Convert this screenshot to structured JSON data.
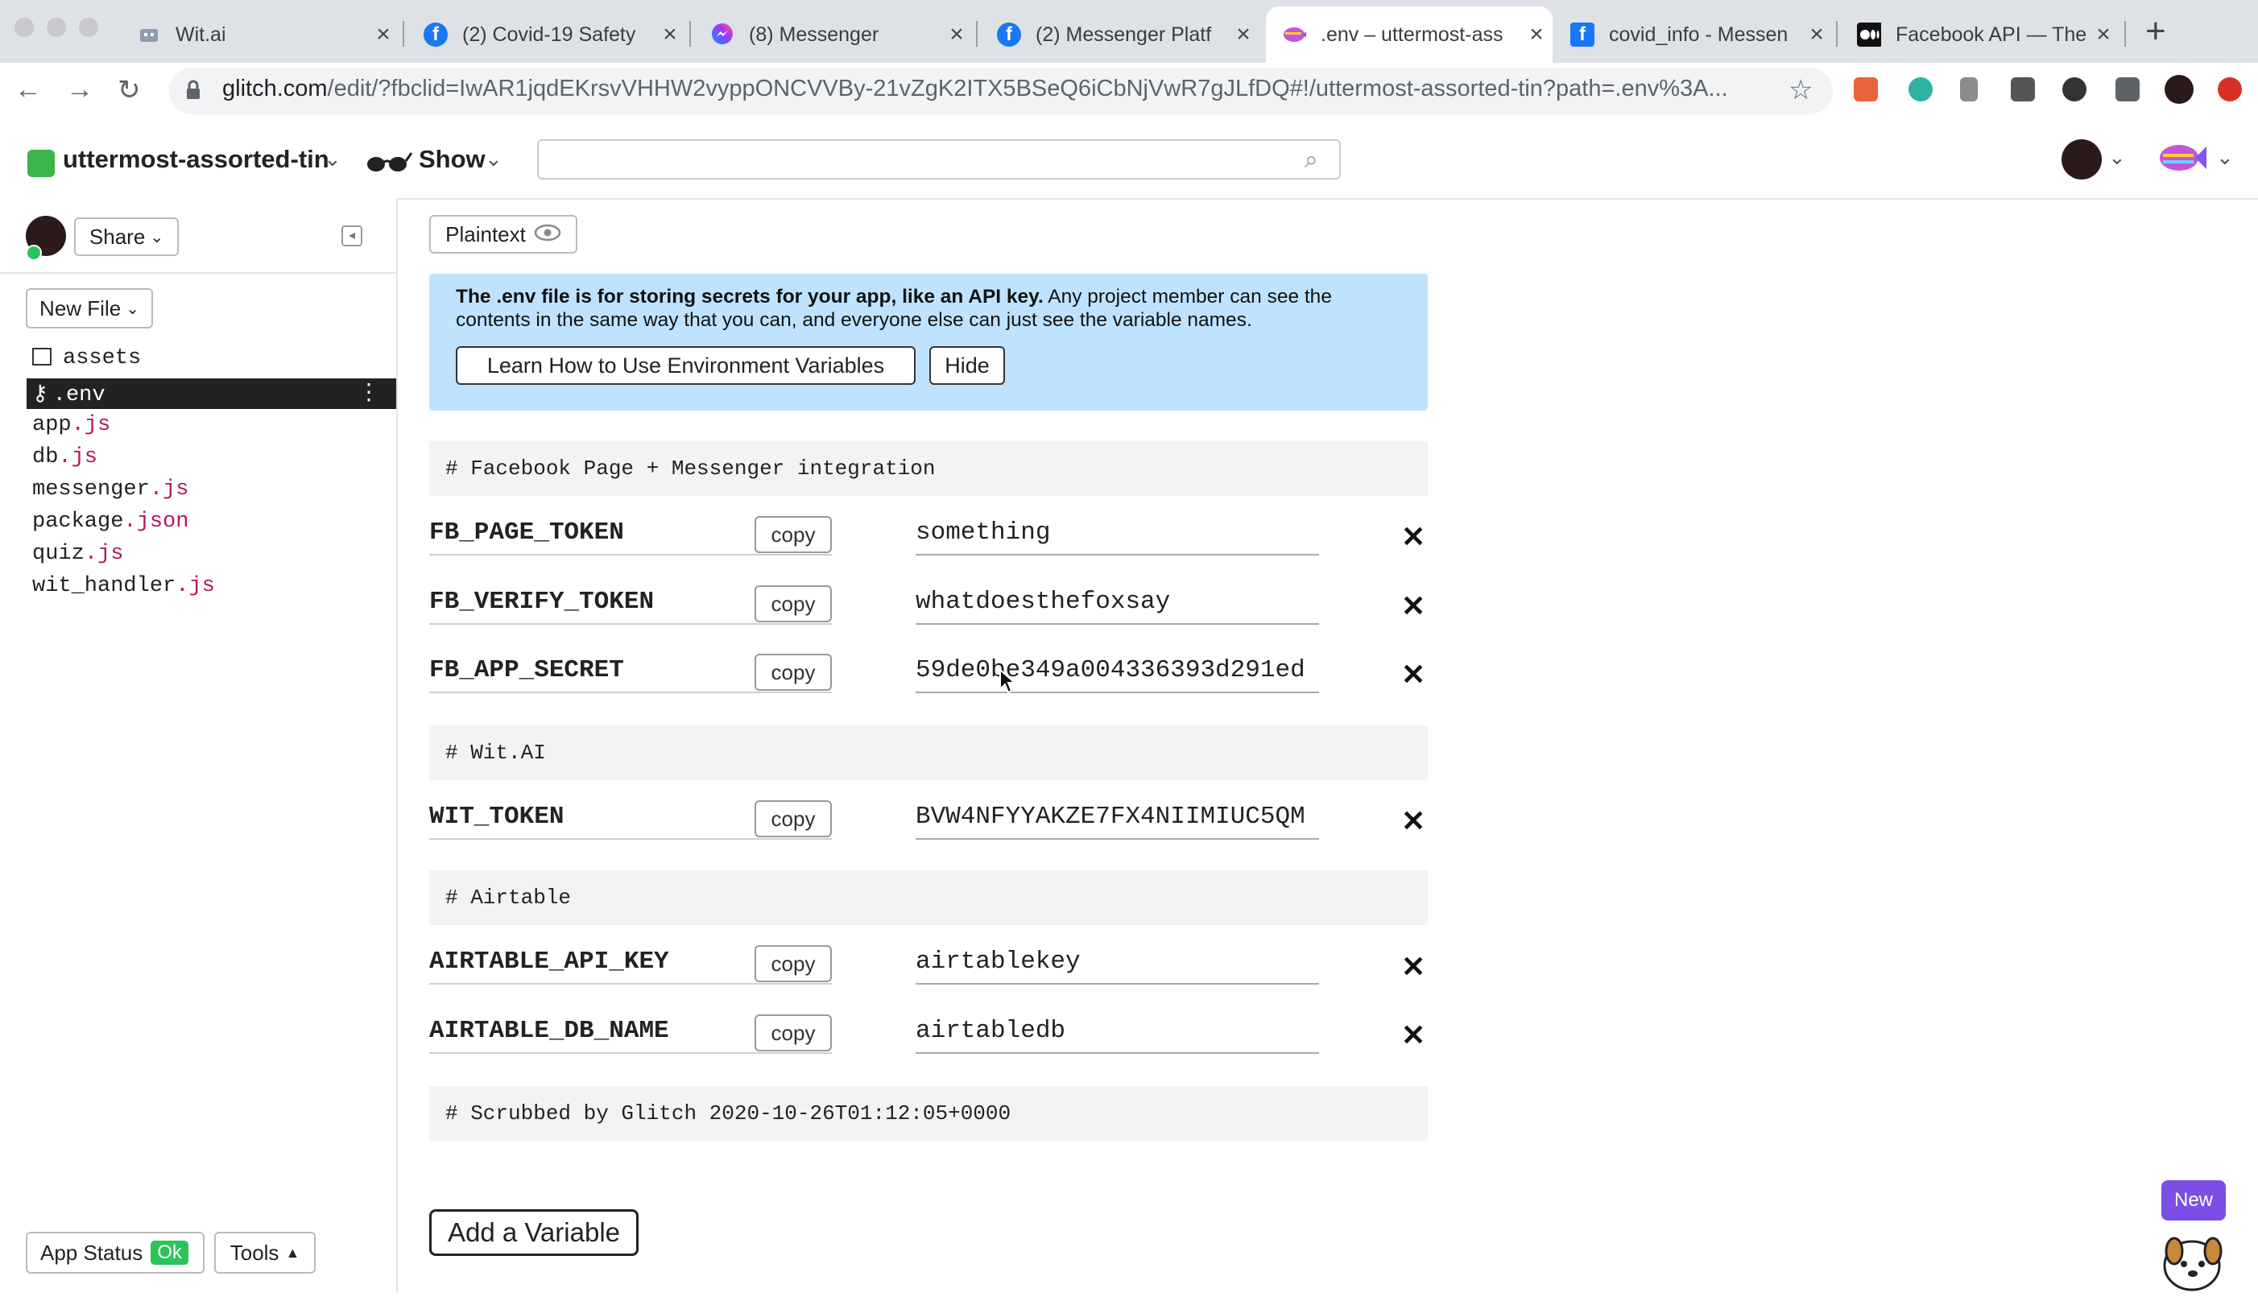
{
  "browser": {
    "tabs": [
      {
        "title": "Wit.ai",
        "icon": "wit-robot-icon"
      },
      {
        "title": "(2) Covid-19 Safety",
        "icon": "facebook-icon"
      },
      {
        "title": "(8) Messenger",
        "icon": "messenger-icon"
      },
      {
        "title": "(2) Messenger Platf",
        "icon": "facebook-icon"
      },
      {
        "title": ".env – uttermost-ass",
        "icon": "glitch-fish-icon"
      },
      {
        "title": "covid_info - Messen",
        "icon": "facebook-square-icon"
      },
      {
        "title": "Facebook API — The",
        "icon": "medium-icon"
      }
    ],
    "url_host": "glitch.com",
    "url_path": "/edit/?fbclid=IwAR1jqdEKrsvVHHW2vyppONCVVBy-21vZgK2ITX5BSeQ6iCbNjVwR7gJLfDQ#!/uttermost-assorted-tin?path=.env%3A..."
  },
  "header": {
    "project_name": "uttermost-assorted-tin",
    "show_label": "Show"
  },
  "sidebar": {
    "share_label": "Share",
    "new_file_label": "New File",
    "files": [
      {
        "base": "assets",
        "ext": ""
      },
      {
        "base": ".env",
        "ext": ""
      },
      {
        "base": "app",
        "ext": ".js"
      },
      {
        "base": "db",
        "ext": ".js"
      },
      {
        "base": "messenger",
        "ext": ".js"
      },
      {
        "base": "package",
        "ext": ".json"
      },
      {
        "base": "quiz",
        "ext": ".js"
      },
      {
        "base": "wit_handler",
        "ext": ".js"
      }
    ],
    "app_status_label": "App Status",
    "app_status_badge": "Ok",
    "tools_label": "Tools"
  },
  "editor": {
    "plaintext_label": "Plaintext",
    "banner_bold": "The .env file is for storing secrets for your app, like an API key.",
    "banner_rest": " Any project member can see the contents in the same way that you can, and everyone else can just see the variable names.",
    "learn_button": "Learn How to Use Environment Variables",
    "hide_button": "Hide",
    "copy_label": "copy",
    "comments": [
      "# Facebook Page + Messenger integration",
      "# Wit.AI",
      "# Airtable",
      "# Scrubbed by Glitch 2020-10-26T01:12:05+0000"
    ],
    "variables": [
      {
        "name": "FB_PAGE_TOKEN",
        "value": "something"
      },
      {
        "name": "FB_VERIFY_TOKEN",
        "value": "whatdoesthefoxsay"
      },
      {
        "name": "FB_APP_SECRET",
        "value": "59de0be349a004336393d291ed"
      },
      {
        "name": "WIT_TOKEN",
        "value": "BVW4NFYYAKZE7FX4NIIMIUC5QM"
      },
      {
        "name": "AIRTABLE_API_KEY",
        "value": "airtablekey"
      },
      {
        "name": "AIRTABLE_DB_NAME",
        "value": "airtabledb"
      }
    ],
    "add_variable_label": "Add a Variable",
    "new_badge": "New"
  },
  "colors": {
    "banner_bg": "#bfe3ff",
    "file_ext": "#b5185d",
    "status_ok": "#2ec25b",
    "new_badge": "#7b4ee6"
  }
}
